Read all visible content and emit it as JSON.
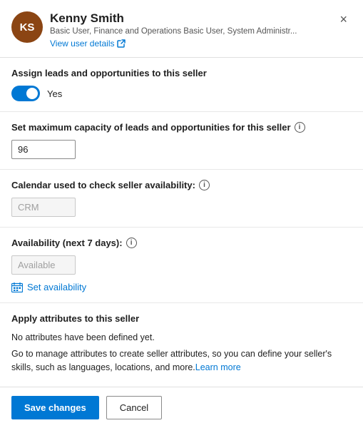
{
  "header": {
    "avatar_initials": "KS",
    "name": "Kenny Smith",
    "roles": "Basic User, Finance and Operations Basic User, System Administr...",
    "view_user_details_label": "View user details",
    "close_label": "×"
  },
  "assign_section": {
    "label": "Assign leads and opportunities to this seller",
    "toggle_value": true,
    "toggle_yes_label": "Yes"
  },
  "capacity_section": {
    "label": "Set maximum capacity of leads and opportunities for this seller",
    "info_icon": "i",
    "value": "96"
  },
  "calendar_section": {
    "label": "Calendar used to check seller availability:",
    "info_icon": "i",
    "value": "CRM"
  },
  "availability_section": {
    "label": "Availability (next 7 days):",
    "info_icon": "i",
    "value": "Available",
    "set_availability_label": "Set availability"
  },
  "attributes_section": {
    "label": "Apply attributes to this seller",
    "no_attributes_text": "No attributes have been defined yet.",
    "description_text": "Go to manage attributes to create seller attributes, so you can define your seller's skills, such as languages, locations, and more.",
    "learn_more_label": "Learn more"
  },
  "footer": {
    "save_label": "Save changes",
    "cancel_label": "Cancel"
  }
}
